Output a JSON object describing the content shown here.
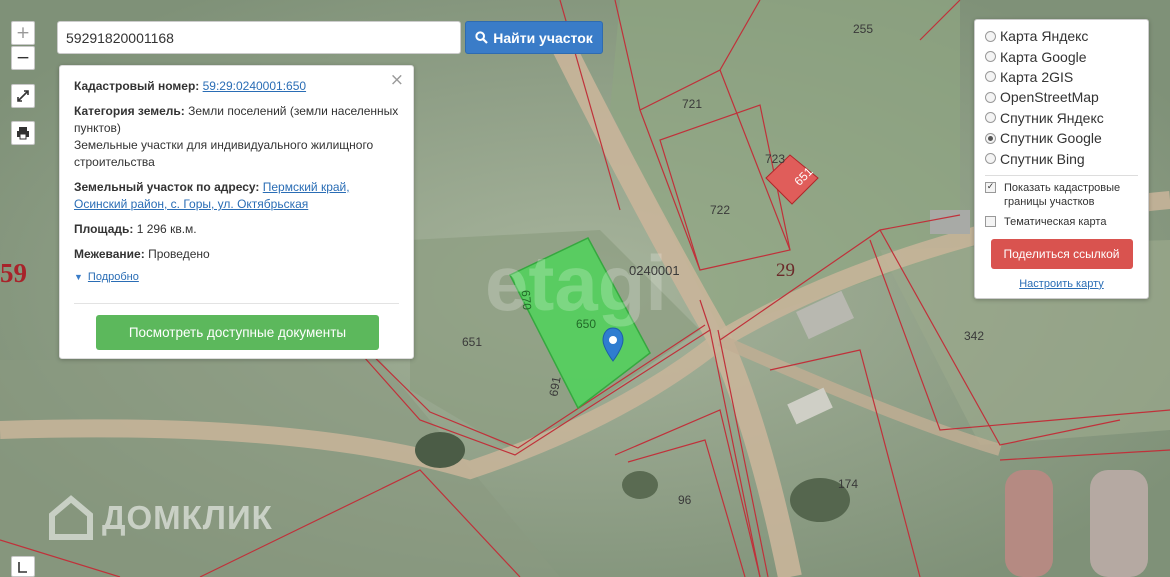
{
  "search": {
    "value": "59291820001168",
    "button_label": "Найти участок"
  },
  "map_controls": {
    "zoom_in": "+",
    "zoom_out": "−"
  },
  "info": {
    "cadastral_label": "Кадастровый номер:",
    "cadastral_value": "59:29:0240001:650",
    "category_label": "Категория земель:",
    "category_value": "Земли поселений (земли населенных пунктов)",
    "usage": "Земельные участки для индивидуального жилищного строительства",
    "address_label": "Земельный участок по адресу:",
    "address_value": "Пермский край, Осинский район, с. Горы, ул. Октябрьская",
    "area_label": "Площадь:",
    "area_value": "1 296 кв.м.",
    "survey_label": "Межевание:",
    "survey_value": "Проведено",
    "more_label": "Подробно",
    "docs_button": "Посмотреть доступные документы",
    "close": "×"
  },
  "layers": {
    "options": [
      {
        "label": "Карта Яндекс",
        "selected": false
      },
      {
        "label": "Карта Google",
        "selected": false
      },
      {
        "label": "Карта 2GIS",
        "selected": false
      },
      {
        "label": "OpenStreetMap",
        "selected": false
      },
      {
        "label": "Спутник Яндекс",
        "selected": false
      },
      {
        "label": "Спутник Google",
        "selected": true
      },
      {
        "label": "Спутник Bing",
        "selected": false
      }
    ],
    "show_borders_label": "Показать кадастровые границы участков",
    "show_borders_checked": true,
    "thematic_label": "Тематическая карта",
    "thematic_checked": false,
    "share_button": "Поделиться ссылкой",
    "settings_link": "Настроить карту"
  },
  "map_labels": {
    "region": "59",
    "district": "29",
    "quarter": "0240001",
    "p255": "255",
    "p721": "721",
    "p723": "723",
    "p651_red": "651",
    "p722": "722",
    "p650": "650",
    "p651": "651",
    "p691": "691",
    "p670": "670",
    "p342": "342",
    "p174": "174",
    "p96": "96"
  },
  "watermark": {
    "text": "ДОМКЛИК",
    "overlay_text": "etagi"
  },
  "colors": {
    "selected_parcel": "#4fd35a",
    "parcel_border": "#c0313a",
    "red_parcel": "#e05d5a",
    "search_button": "#3a7cc8",
    "docs_button": "#5cb85c",
    "share_button": "#d9534f"
  }
}
